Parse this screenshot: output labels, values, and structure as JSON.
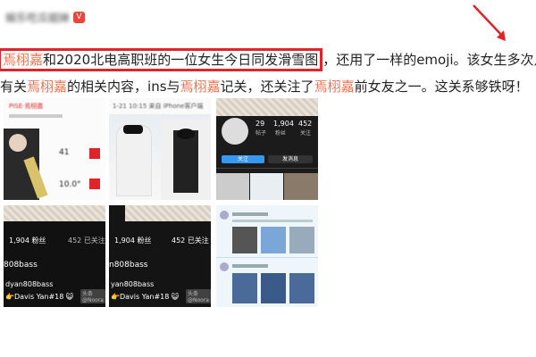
{
  "header": {
    "username": "娱乐吃瓜姐妹",
    "vip_badge": "V"
  },
  "post": {
    "line1": [
      {
        "text": "焉栩嘉",
        "hl": true,
        "boxed": true
      },
      {
        "text": "和2020北电高职班的一位女生今日同发滑雪图",
        "hl": false,
        "boxed": true
      },
      {
        "text": "，还用了一样的emoji。该女生多次点赞",
        "hl": false,
        "boxed": false
      }
    ],
    "line2": [
      {
        "text": "有关",
        "hl": false
      },
      {
        "text": "焉栩嘉",
        "hl": true
      },
      {
        "text": "的相关内容，ins与",
        "hl": false
      },
      {
        "text": "焉栩嘉",
        "hl": true
      },
      {
        "text": "记关，还关注了",
        "hl": false
      },
      {
        "text": "焉栩嘉",
        "hl": true
      },
      {
        "text": "前女友之一。这关系够铁呀！",
        "hl": false
      }
    ]
  },
  "images": {
    "img1": {
      "top_text": "PISE·焉栩嘉",
      "stat1": "41",
      "stat2": "10.0°"
    },
    "img2": {
      "top_text": "1-21 10:15  来自 iPhone客户端"
    },
    "img3": {
      "stats": [
        "29",
        "1,904",
        "452"
      ],
      "labels": [
        "帖子",
        "粉丝",
        "关注"
      ],
      "btn_follow": "关注",
      "btn_msg": "发消息"
    },
    "img4": {
      "fans": "1,904 粉丝",
      "following": "452 已关注",
      "handle": "808bass",
      "name": "dyan808bass",
      "bio": "👉Davis Yan#18 😺"
    },
    "img5": {
      "fans": "1,904 粉丝",
      "following": "452 已关注",
      "handle": "n808bass",
      "name": "yan808bass",
      "bio": "👉Davis Yan#18 😺"
    },
    "watermark": "头条 @Noora"
  }
}
